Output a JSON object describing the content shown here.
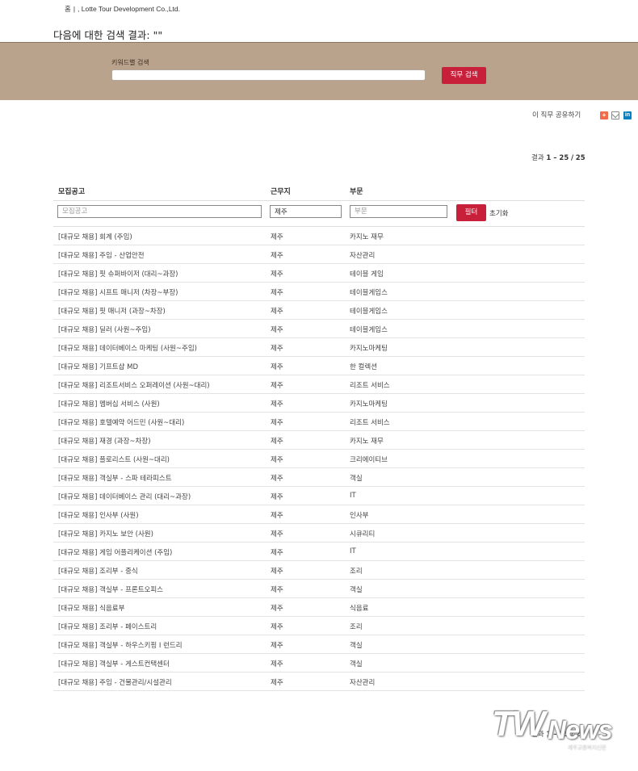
{
  "breadcrumb": {
    "home": "홈",
    "company": "Lotte Tour Development Co.,Ltd."
  },
  "search_title": "다음에 대한 검색 결과: \"\"",
  "search": {
    "label": "키워드별 검색",
    "value": "",
    "placeholder": "",
    "button": "직무 검색"
  },
  "share": {
    "label": "이 직무 공유하기",
    "icons": [
      "add-icon",
      "mail-icon",
      "linkedin-icon"
    ]
  },
  "results": {
    "prefix": "결과",
    "range": "1 – 25",
    "total": "25"
  },
  "table": {
    "headers": {
      "title": "모집공고",
      "location": "근무지",
      "department": "부문"
    },
    "filters": {
      "title_placeholder": "모집공고",
      "location_value": "제주",
      "department_placeholder": "부문",
      "filter_button": "필터",
      "reset": "초기화"
    },
    "rows": [
      {
        "title": "[대규모 채용] 회계 (주임)",
        "location": "제주",
        "department": "카지노 재무"
      },
      {
        "title": "[대규모 채용] 주임 - 산업안전",
        "location": "제주",
        "department": "자산관리"
      },
      {
        "title": "[대규모 채용] 핏 슈퍼바이저 (대리~과장)",
        "location": "제주",
        "department": "테이블 게임"
      },
      {
        "title": "[대규모 채용] 시프트 매니저 (차장~부장)",
        "location": "제주",
        "department": "테이블게임스"
      },
      {
        "title": "[대규모 채용] 핏 매니저 (과장~차장)",
        "location": "제주",
        "department": "테이블게임스"
      },
      {
        "title": "[대규모 채용] 딜러 (사원~주임)",
        "location": "제주",
        "department": "테이블게임스"
      },
      {
        "title": "[대규모 채용] 데이터베이스 마케팅 (사원~주임)",
        "location": "제주",
        "department": "카지노마케팅"
      },
      {
        "title": "[대규모 채용] 기프트샵 MD",
        "location": "제주",
        "department": "한 컬렉션"
      },
      {
        "title": "[대규모 채용] 리조트서비스 오퍼레이션 (사원~대리)",
        "location": "제주",
        "department": "리조트 서비스"
      },
      {
        "title": "[대규모 채용] 멤버십 서비스 (사원)",
        "location": "제주",
        "department": "카지노마케팅"
      },
      {
        "title": "[대규모 채용] 호텔예약 어드민 (사원~대리)",
        "location": "제주",
        "department": "리조트 서비스"
      },
      {
        "title": "[대규모 채용] 재경 (과장~차장)",
        "location": "제주",
        "department": "카지노 재무"
      },
      {
        "title": "[대규모 채용] 플로리스트 (사원~대리)",
        "location": "제주",
        "department": "크리에이티브"
      },
      {
        "title": "[대규모 채용] 객실부 - 스파 테라피스트",
        "location": "제주",
        "department": "객실"
      },
      {
        "title": "[대규모 채용] 데이터베이스 관리 (대리~과장)",
        "location": "제주",
        "department": "IT"
      },
      {
        "title": "[대규모 채용] 인사부 (사원)",
        "location": "제주",
        "department": "인사부"
      },
      {
        "title": "[대규모 채용] 카지노 보안 (사원)",
        "location": "제주",
        "department": "시큐리티"
      },
      {
        "title": "[대규모 채용] 게임 어플리케이션 (주임)",
        "location": "제주",
        "department": "IT"
      },
      {
        "title": "[대규모 채용] 조리부 - 중식",
        "location": "제주",
        "department": "조리"
      },
      {
        "title": "[대규모 채용] 객실부 - 프론트오피스",
        "location": "제주",
        "department": "객실"
      },
      {
        "title": "[대규모 채용] 식음료부",
        "location": "제주",
        "department": "식음료"
      },
      {
        "title": "[대규모 채용] 조리부 - 페이스트리",
        "location": "제주",
        "department": "조리"
      },
      {
        "title": "[대규모 채용] 객실부 - 하우스키핑 I 런드리",
        "location": "제주",
        "department": "객실"
      },
      {
        "title": "[대규모 채용] 객실부 - 게스트컨택센터",
        "location": "제주",
        "department": "객실"
      },
      {
        "title": "[대규모 채용] 주임 - 건물관리/시설관리",
        "location": "제주",
        "department": "자산관리"
      }
    ]
  },
  "footer_results": {
    "prefix": "결과",
    "range": "1 – 25",
    "total": "25"
  },
  "watermark": {
    "brand_tw": "TW",
    "brand_news": "News",
    "subtitle": "제주교통복지신문"
  },
  "colors": {
    "search_band": "#baa38c",
    "accent_button": "#c8203b"
  }
}
